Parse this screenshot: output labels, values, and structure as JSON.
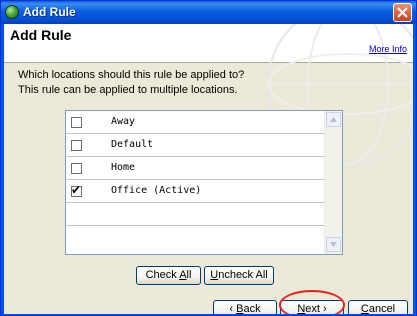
{
  "window": {
    "title": "Add Rule"
  },
  "header": {
    "page_title": "Add Rule",
    "more_info": "More Info"
  },
  "prompt": {
    "question": "Which locations should this rule be applied to?",
    "note": "This rule can be applied to multiple locations."
  },
  "locations": [
    {
      "label": "Away",
      "checked": false
    },
    {
      "label": "Default",
      "checked": false
    },
    {
      "label": "Home",
      "checked": false
    },
    {
      "label": "Office (Active)",
      "checked": true
    }
  ],
  "buttons": {
    "check_all_pre": "Check ",
    "check_all_key": "A",
    "check_all_post": "ll",
    "uncheck_all_key": "U",
    "uncheck_all_post": "ncheck All",
    "back_arrow": "‹ ",
    "back_key": "B",
    "back_post": "ack",
    "next_key": "N",
    "next_post": "ext ›",
    "cancel_key": "C",
    "cancel_post": "ancel"
  },
  "colors": {
    "highlight": "#e52420",
    "titlebar": "#0054e3",
    "link": "#0000ee"
  },
  "icons": {
    "window": "globe-icon",
    "close": "close-icon",
    "scroll_up": "scroll-up-arrow-icon",
    "scroll_down": "scroll-down-arrow-icon"
  }
}
